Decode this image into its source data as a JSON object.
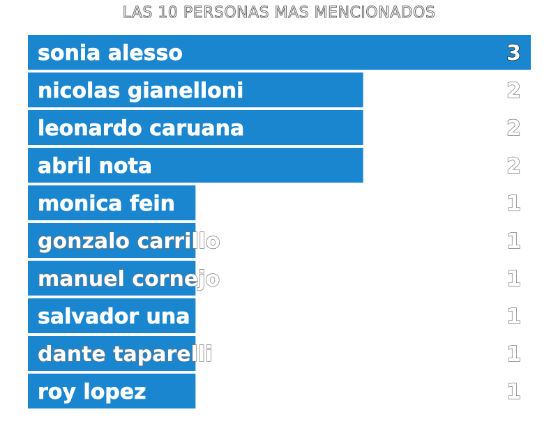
{
  "title": "LAS 10 PERSONAS MAS MENCIONADOS",
  "colors": {
    "bar": "#1a86cf",
    "background": "#ffffff"
  },
  "chart_data": {
    "type": "bar",
    "orientation": "horizontal",
    "title": "LAS 10 PERSONAS MAS MENCIONADOS",
    "categories": [
      "sonia alesso",
      "nicolas gianelloni",
      "leonardo caruana",
      "abril nota",
      "monica fein",
      "gonzalo carrillo",
      "manuel cornejo",
      "salvador una",
      "dante taparelli",
      "roy lopez"
    ],
    "values": [
      3,
      2,
      2,
      2,
      1,
      1,
      1,
      1,
      1,
      1
    ],
    "xlim": [
      0,
      3
    ],
    "grid": false,
    "legend": "none"
  }
}
